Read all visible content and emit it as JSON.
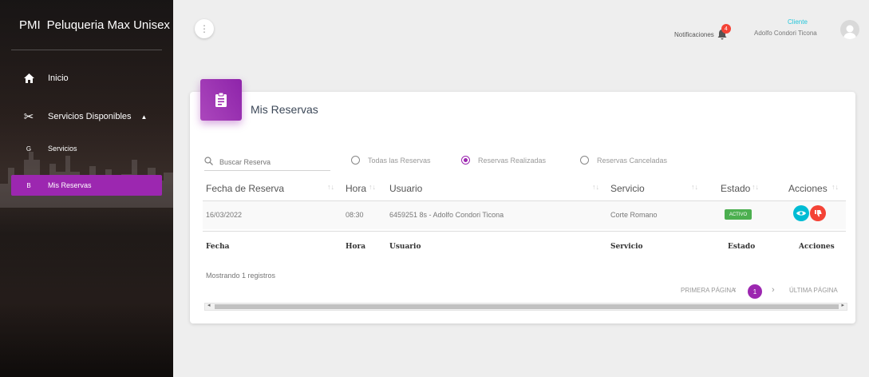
{
  "sidebar": {
    "brand_abbr": "PMI",
    "brand_name": "Peluqueria Max Unisex",
    "items": [
      {
        "label": "Inicio"
      },
      {
        "label": "Servicios Disponibles"
      },
      {
        "letter": "G",
        "label": "Servicios"
      },
      {
        "letter": "B",
        "label": "Mis Reservas"
      }
    ]
  },
  "topbar": {
    "menu_icon": "⋮",
    "notifications_label": "Notificaciones",
    "notifications_count": "4",
    "user_role": "Cliente",
    "user_name": "Adolfo Condori Ticona"
  },
  "card": {
    "title": "Mis Reservas",
    "search_placeholder": "Buscar Reserva",
    "filters": [
      {
        "label": "Todas las Reservas",
        "checked": false
      },
      {
        "label": "Reservas Realizadas",
        "checked": true
      },
      {
        "label": "Reservas Canceladas",
        "checked": false
      }
    ],
    "columns": [
      "Fecha de Reserva",
      "Hora",
      "Usuario",
      "Servicio",
      "Estado",
      "Acciones"
    ],
    "rows": [
      {
        "fecha": "16/03/2022",
        "hora": "08:30",
        "usuario": "6459251 8s - Adolfo Condori Ticona",
        "servicio": "Corte Romano",
        "estado": "ACTIVO"
      }
    ],
    "footer_columns": [
      "Fecha",
      "Hora",
      "Usuario",
      "Servicio",
      "Estado",
      "Acciones"
    ],
    "showing_text": "Mostrando 1 registros",
    "pagination": {
      "first": "PRIMERA PÁGINA",
      "prev": "‹",
      "current": "1",
      "next": "›",
      "last": "ÚLTIMA PÁGINA"
    }
  },
  "colors": {
    "accent": "#9c27b0",
    "status_active": "#4caf50",
    "view_button": "#00bcd4",
    "cancel_button": "#f44336"
  }
}
